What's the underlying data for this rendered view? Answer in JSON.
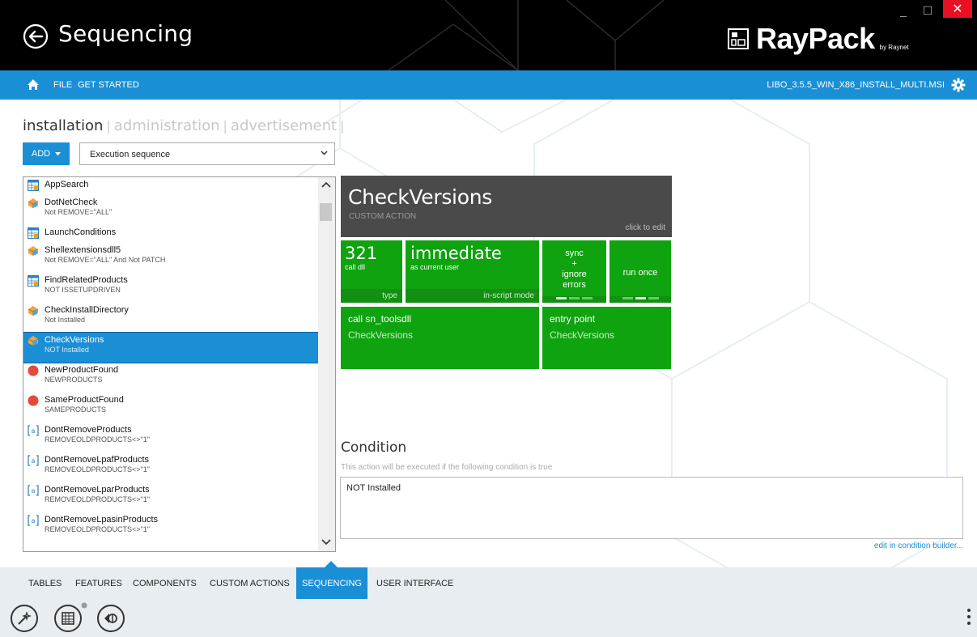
{
  "app": {
    "title": "Sequencing",
    "brand": "RayPack",
    "brand_sub": "by Raynet",
    "window_controls": {
      "minimize": "_",
      "maximize": "☐",
      "close": "✕"
    }
  },
  "menubar": {
    "items": [
      "FILE",
      "GET STARTED"
    ],
    "filename": "LIBO_3.5.5_WIN_X86_INSTALL_MULTI.MSI"
  },
  "sequence_tabs": {
    "active": "installation",
    "items": [
      "administration",
      "advertisement"
    ],
    "separator": "|"
  },
  "add_button": {
    "label": "ADD"
  },
  "sequence_select": {
    "value": "Execution sequence"
  },
  "actions": [
    {
      "name": "AppSearch",
      "sub": "",
      "icon": "table-icon"
    },
    {
      "name": "DotNetCheck",
      "sub": "Not REMOVE=\"ALL\"",
      "icon": "custom-action-icon"
    },
    {
      "name": "LaunchConditions",
      "sub": "",
      "icon": "table-icon"
    },
    {
      "name": "Shellextensionsdll5",
      "sub": "Not REMOVE=\"ALL\" And Not PATCH",
      "icon": "custom-action-icon"
    },
    {
      "name": "FindRelatedProducts",
      "sub": "NOT ISSETUPDRIVEN",
      "icon": "table-icon"
    },
    {
      "name": "CheckInstallDirectory",
      "sub": "Not Installed",
      "icon": "custom-action-icon"
    },
    {
      "name": "CheckVersions",
      "sub": "NOT Installed",
      "icon": "custom-action-icon",
      "selected": true
    },
    {
      "name": "NewProductFound",
      "sub": "NEWPRODUCTS",
      "icon": "error-icon"
    },
    {
      "name": "SameProductFound",
      "sub": "SAMEPRODUCTS",
      "icon": "error-icon"
    },
    {
      "name": "DontRemoveProducts",
      "sub": "REMOVEOLDPRODUCTS<>\"1\"",
      "icon": "property-icon"
    },
    {
      "name": "DontRemoveLpafProducts",
      "sub": "REMOVEOLDPRODUCTS<>\"1\"",
      "icon": "property-icon"
    },
    {
      "name": "DontRemoveLparProducts",
      "sub": "REMOVEOLDPRODUCTS<>\"1\"",
      "icon": "property-icon"
    },
    {
      "name": "DontRemoveLpasinProducts",
      "sub": "REMOVEOLDPRODUCTS<>\"1\"",
      "icon": "property-icon"
    }
  ],
  "detail": {
    "title": "CheckVersions",
    "subtitle": "CUSTOM ACTION",
    "edit_hint": "click to edit",
    "type_tile": {
      "value": "321",
      "desc": "call dll",
      "footer": "type"
    },
    "mode_tile": {
      "value": "immediate",
      "desc": "as current user",
      "footer": "in-script mode"
    },
    "sync_tile": {
      "line1": "sync",
      "line2": "+",
      "line3": "ignore",
      "line4": "errors",
      "selected_option": 1,
      "option_count": 3
    },
    "run_tile": {
      "label": "run once",
      "selected_option": 2,
      "option_count": 3
    },
    "call_tile": {
      "label": "call sn_toolsdll",
      "value": "CheckVersions"
    },
    "entry_tile": {
      "label": "entry point",
      "value": "CheckVersions"
    }
  },
  "condition": {
    "title": "Condition",
    "description": "This action will be executed if the following condition is true",
    "value": "NOT Installed",
    "link": "edit in condition builder..."
  },
  "bottom_tabs": {
    "items": [
      "TABLES",
      "FEATURES",
      "COMPONENTS",
      "CUSTOM ACTIONS",
      "SEQUENCING",
      "USER INTERFACE"
    ],
    "active": "SEQUENCING"
  },
  "toolbar": {
    "buttons": [
      "wizard-icon",
      "table-view-icon",
      "package-icon"
    ]
  },
  "colors": {
    "accent": "#1a8fd6",
    "tile_green": "#0fa30f",
    "tile_dark": "#4a4a4a",
    "titlebar": "#000000"
  }
}
